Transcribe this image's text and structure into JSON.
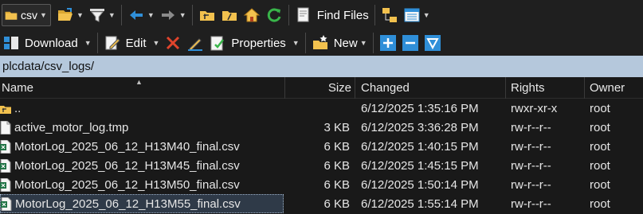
{
  "toolbar1": {
    "folder_combo_label": "csv",
    "find_files_label": "Find Files",
    "icons": [
      "folder-icon",
      "open-folder-icon",
      "filter-icon",
      "back-arrow-icon",
      "forward-arrow-icon",
      "parent-dir-icon",
      "root-dir-icon",
      "home-icon",
      "refresh-icon",
      "find-files-icon",
      "tree-icon",
      "view-details-icon"
    ]
  },
  "toolbar2": {
    "download_label": "Download",
    "edit_label": "Edit",
    "properties_label": "Properties",
    "new_label": "New",
    "icons": [
      "download-icon",
      "edit-icon",
      "delete-icon",
      "rename-icon",
      "properties-icon",
      "new-icon",
      "plus-icon",
      "minus-icon",
      "select-filter-icon"
    ]
  },
  "address": {
    "path": "plcdata/csv_logs/"
  },
  "columns": {
    "name": "Name",
    "size": "Size",
    "changed": "Changed",
    "rights": "Rights",
    "owner": "Owner"
  },
  "files": [
    {
      "name": "..",
      "size": "",
      "changed": "6/12/2025 1:35:16 PM",
      "rights": "rwxr-xr-x",
      "owner": "root",
      "type": "parent"
    },
    {
      "name": "active_motor_log.tmp",
      "size": "3 KB",
      "changed": "6/12/2025 3:36:28 PM",
      "rights": "rw-r--r--",
      "owner": "root",
      "type": "file"
    },
    {
      "name": "MotorLog_2025_06_12_H13M40_final.csv",
      "size": "6 KB",
      "changed": "6/12/2025 1:40:15 PM",
      "rights": "rw-r--r--",
      "owner": "root",
      "type": "csv"
    },
    {
      "name": "MotorLog_2025_06_12_H13M45_final.csv",
      "size": "6 KB",
      "changed": "6/12/2025 1:45:15 PM",
      "rights": "rw-r--r--",
      "owner": "root",
      "type": "csv"
    },
    {
      "name": "MotorLog_2025_06_12_H13M50_final.csv",
      "size": "6 KB",
      "changed": "6/12/2025 1:50:14 PM",
      "rights": "rw-r--r--",
      "owner": "root",
      "type": "csv"
    },
    {
      "name": "MotorLog_2025_06_12_H13M55_final.csv",
      "size": "6 KB",
      "changed": "6/12/2025 1:55:14 PM",
      "rights": "rw-r--r--",
      "owner": "root",
      "type": "csv"
    }
  ],
  "colors": {
    "background": "#191919",
    "address_bar": "#b5c8dc",
    "folder": "#f2c14e",
    "accent_blue": "#2f8fd8",
    "excel_green": "#1f7244",
    "delete_red": "#e0442c"
  }
}
